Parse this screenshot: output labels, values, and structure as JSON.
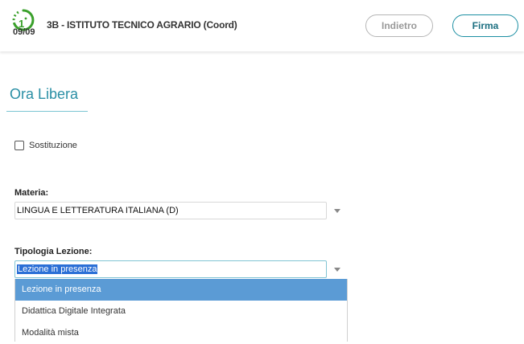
{
  "header": {
    "hour_number": "09/09",
    "class_title": "3B - ISTITUTO TECNICO AGRARIO (Coord)",
    "back_label": "Indietro",
    "sign_label": "Firma",
    "accent_color": "#2a8fa5",
    "clock_color": "#3aa02b"
  },
  "section": {
    "title": "Ora Libera"
  },
  "substitution": {
    "label": "Sostituzione",
    "checked": false
  },
  "materia": {
    "label": "Materia:",
    "value": "LINGUA E LETTERATURA ITALIANA (D)"
  },
  "tipologia": {
    "label": "Tipologia Lezione:",
    "value": "Lezione in presenza",
    "options": [
      "Lezione in presenza",
      "Didattica Digitale Integrata",
      "Modalità mista"
    ],
    "active_index": 0
  },
  "icons": {
    "clock": "clock-icon",
    "dropdown_arrow": "chevron-down-icon"
  }
}
